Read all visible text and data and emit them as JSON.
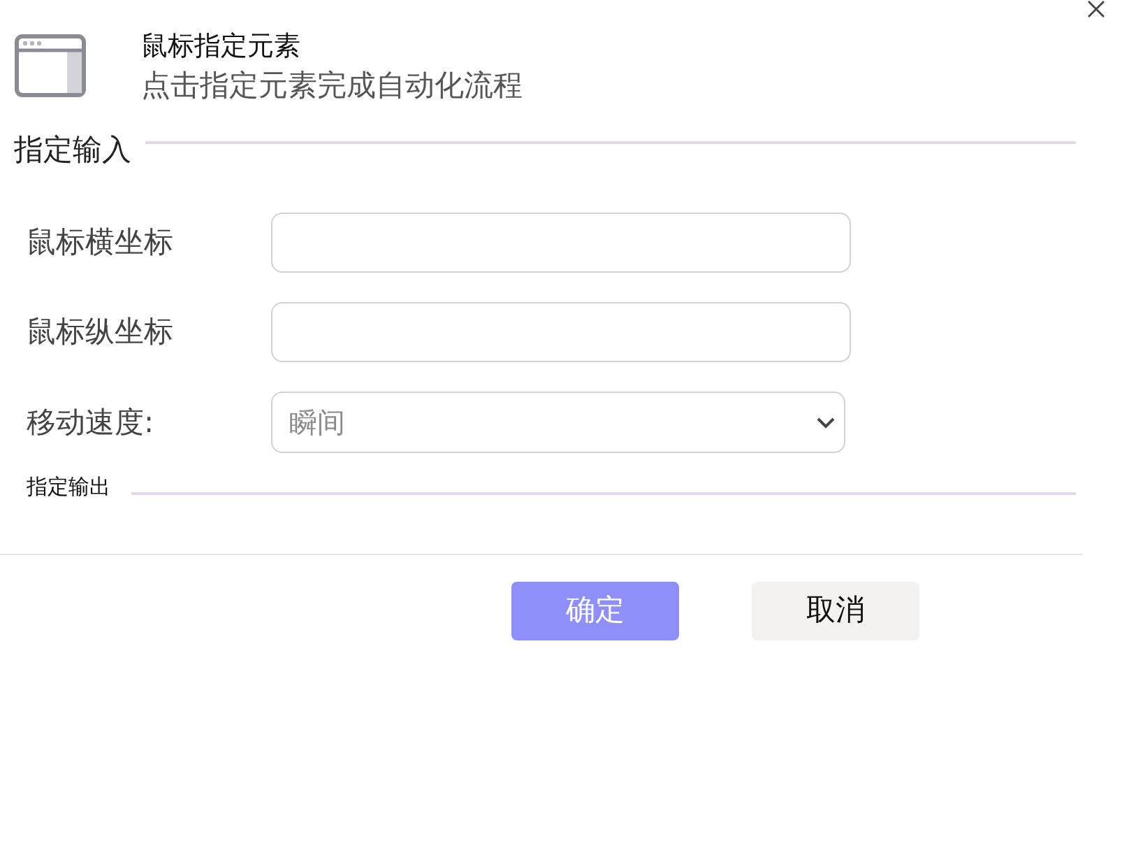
{
  "header": {
    "title": "鼠标指定元素",
    "subtitle": "点击指定元素完成自动化流程"
  },
  "input_section": {
    "title": "指定输入",
    "fields": [
      {
        "kind": "text",
        "label": "鼠标横坐标"
      },
      {
        "kind": "text",
        "label": "鼠标纵坐标"
      },
      {
        "kind": "select",
        "label": "移动速度:",
        "value": "瞬间"
      }
    ]
  },
  "output_section": {
    "title": "指定输出"
  },
  "buttons": [
    {
      "kind": "primary",
      "label": "确定"
    },
    {
      "kind": "secondary",
      "label": "取消"
    }
  ]
}
